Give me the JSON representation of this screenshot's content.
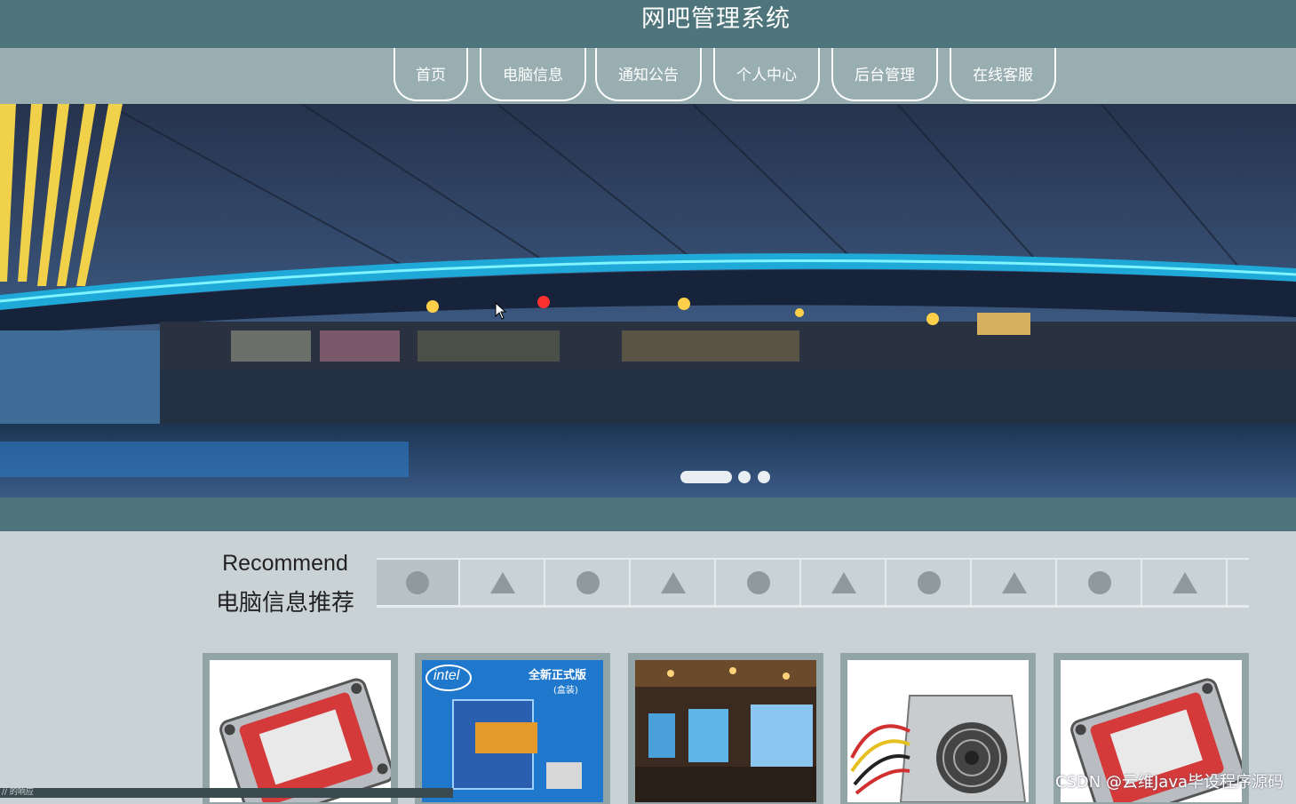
{
  "header": {
    "site_title": "网吧管理系统"
  },
  "nav": {
    "items": [
      {
        "label": "首页"
      },
      {
        "label": "电脑信息"
      },
      {
        "label": "通知公告"
      },
      {
        "label": "个人中心"
      },
      {
        "label": "后台管理"
      },
      {
        "label": "在线客服"
      }
    ]
  },
  "carousel": {
    "slide_count": 3,
    "active_index": 0
  },
  "recommend": {
    "title_en": "Recommend",
    "title_cn": "电脑信息推荐",
    "tab_icons": [
      "circle-icon",
      "triangle-icon",
      "circle-icon",
      "triangle-icon",
      "circle-icon",
      "triangle-icon",
      "circle-icon",
      "triangle-icon",
      "circle-icon",
      "triangle-icon"
    ],
    "active_tab": 0,
    "products": [
      {
        "image": "hard-drive-image",
        "badge": ""
      },
      {
        "image": "intel-cpu-box-image",
        "badge": "全新正式版",
        "badge_sub": "(盒装)",
        "brand": "intel"
      },
      {
        "image": "internet-cafe-image",
        "badge": ""
      },
      {
        "image": "power-supply-image",
        "badge": ""
      },
      {
        "image": "hard-drive-image",
        "badge": ""
      }
    ]
  },
  "watermark": "CSDN @云维Java毕设程序源码",
  "status_strip": "// 的响应"
}
